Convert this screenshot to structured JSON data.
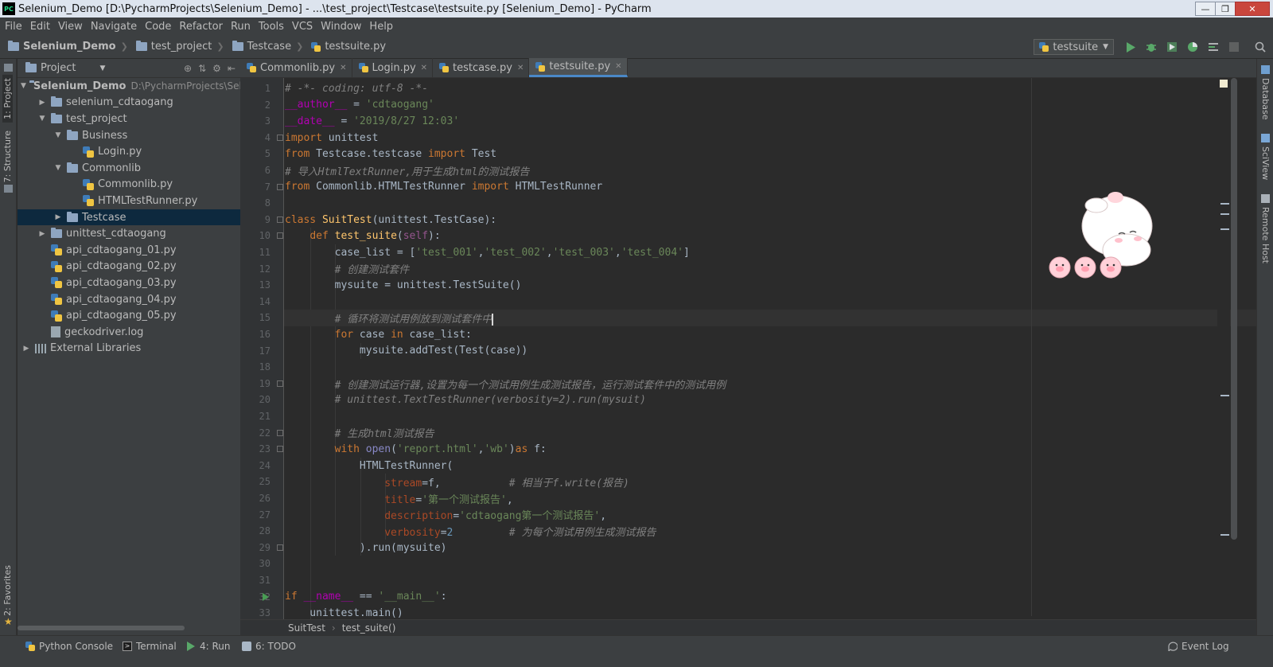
{
  "window": {
    "title": "Selenium_Demo [D:\\PycharmProjects\\Selenium_Demo] - ...\\test_project\\Testcase\\testsuite.py [Selenium_Demo] - PyCharm",
    "logo": "PC",
    "controls": [
      "minimize-icon",
      "restore-icon",
      "close-icon"
    ]
  },
  "menu": [
    "File",
    "Edit",
    "View",
    "Navigate",
    "Code",
    "Refactor",
    "Run",
    "Tools",
    "VCS",
    "Window",
    "Help"
  ],
  "nav": {
    "crumbs": [
      "Selenium_Demo",
      "test_project",
      "Testcase",
      "testsuite.py"
    ],
    "run_config": "testsuite",
    "tool_icons": [
      "run-icon",
      "debug-icon",
      "run-with-coverage-icon",
      "profile-icon",
      "concurrency-diagram-icon",
      "stop-icon",
      "search-everywhere-icon"
    ]
  },
  "left_tabs": [
    "1: Project",
    "7: Structure",
    "2: Favorites"
  ],
  "right_tabs": [
    "Database",
    "SciView",
    "Remote Host"
  ],
  "project": {
    "header": "Project",
    "header_tools": [
      "target-icon",
      "collapse-icon",
      "gear-icon",
      "hide-icon"
    ],
    "tree": [
      {
        "label": "Selenium_Demo",
        "path": "D:\\PycharmProjects\\Sel",
        "level": 0,
        "arrow": "down",
        "icon": "folder",
        "bold": true
      },
      {
        "label": "selenium_cdtaogang",
        "level": 1,
        "arrow": "right",
        "icon": "folder"
      },
      {
        "label": "test_project",
        "level": 1,
        "arrow": "down",
        "icon": "folder"
      },
      {
        "label": "Business",
        "level": 2,
        "arrow": "down",
        "icon": "folder"
      },
      {
        "label": "Login.py",
        "level": 3,
        "arrow": "none",
        "icon": "python"
      },
      {
        "label": "Commonlib",
        "level": 2,
        "arrow": "down",
        "icon": "folder"
      },
      {
        "label": "Commonlib.py",
        "level": 3,
        "arrow": "none",
        "icon": "python"
      },
      {
        "label": "HTMLTestRunner.py",
        "level": 3,
        "arrow": "none",
        "icon": "python"
      },
      {
        "label": "Testcase",
        "level": 2,
        "arrow": "right",
        "icon": "folder",
        "selected": true
      },
      {
        "label": "unittest_cdtaogang",
        "level": 1,
        "arrow": "right",
        "icon": "folder"
      },
      {
        "label": "api_cdtaogang_01.py",
        "level": 1,
        "arrow": "none",
        "icon": "python"
      },
      {
        "label": "api_cdtaogang_02.py",
        "level": 1,
        "arrow": "none",
        "icon": "python"
      },
      {
        "label": "api_cdtaogang_03.py",
        "level": 1,
        "arrow": "none",
        "icon": "python"
      },
      {
        "label": "api_cdtaogang_04.py",
        "level": 1,
        "arrow": "none",
        "icon": "python"
      },
      {
        "label": "api_cdtaogang_05.py",
        "level": 1,
        "arrow": "none",
        "icon": "python"
      },
      {
        "label": "geckodriver.log",
        "level": 1,
        "arrow": "none",
        "icon": "file"
      },
      {
        "label": "External Libraries",
        "level": 0,
        "arrow": "right",
        "icon": "library"
      }
    ]
  },
  "editor": {
    "tabs": [
      {
        "label": "Commonlib.py",
        "active": false
      },
      {
        "label": "Login.py",
        "active": false
      },
      {
        "label": "testcase.py",
        "active": false
      },
      {
        "label": "testsuite.py",
        "active": true
      }
    ],
    "current_line": 15,
    "lines": [
      [
        [
          "cmt",
          "# -*- coding: utf-8 -*-"
        ]
      ],
      [
        [
          "dunder",
          "__author__"
        ],
        [
          "plain",
          " = "
        ],
        [
          "str",
          "'cdtaogang'"
        ]
      ],
      [
        [
          "dunder",
          "__date__"
        ],
        [
          "plain",
          " = "
        ],
        [
          "str",
          "'2019/8/27 12:03'"
        ]
      ],
      [
        [
          "kw",
          "import"
        ],
        [
          "plain",
          " unittest"
        ]
      ],
      [
        [
          "kw",
          "from"
        ],
        [
          "plain",
          " Testcase.testcase "
        ],
        [
          "kw",
          "import"
        ],
        [
          "plain",
          " Test"
        ]
      ],
      [
        [
          "cmt",
          "# 导入HtmlTextRunner,用于生成html的测试报告"
        ]
      ],
      [
        [
          "kw",
          "from"
        ],
        [
          "plain",
          " Commonlib.HTMLTestRunner "
        ],
        [
          "kw",
          "import"
        ],
        [
          "plain",
          " HTMLTestRunner"
        ]
      ],
      [],
      [
        [
          "kw",
          "class"
        ],
        [
          "plain",
          " "
        ],
        [
          "def",
          "SuitTest"
        ],
        [
          "plain",
          "(unittest.TestCase):"
        ]
      ],
      [
        [
          "plain",
          "    "
        ],
        [
          "kw",
          "def"
        ],
        [
          "plain",
          " "
        ],
        [
          "def",
          "test_suite"
        ],
        [
          "plain",
          "("
        ],
        [
          "self",
          "self"
        ],
        [
          "plain",
          "):"
        ]
      ],
      [
        [
          "plain",
          "        case_list = ["
        ],
        [
          "str",
          "'test_001'"
        ],
        [
          "plain",
          ","
        ],
        [
          "str",
          "'test_002'"
        ],
        [
          "plain",
          ","
        ],
        [
          "str",
          "'test_003'"
        ],
        [
          "plain",
          ","
        ],
        [
          "str",
          "'test_004'"
        ],
        [
          "plain",
          "]"
        ]
      ],
      [
        [
          "plain",
          "        "
        ],
        [
          "cmt",
          "# 创建测试套件"
        ]
      ],
      [
        [
          "plain",
          "        mysuite = unittest.TestSuite()"
        ]
      ],
      [],
      [
        [
          "plain",
          "        "
        ],
        [
          "cmt",
          "# 循环将测试用例放到测试套件中"
        ],
        [
          "cursor",
          ""
        ]
      ],
      [
        [
          "plain",
          "        "
        ],
        [
          "kw",
          "for"
        ],
        [
          "plain",
          " case "
        ],
        [
          "kw",
          "in"
        ],
        [
          "plain",
          " case_list:"
        ]
      ],
      [
        [
          "plain",
          "            mysuite.addTest(Test(case))"
        ]
      ],
      [],
      [
        [
          "plain",
          "        "
        ],
        [
          "cmt",
          "# 创建测试运行器,设置为每一个测试用例生成测试报告，运行测试套件中的测试用例"
        ]
      ],
      [
        [
          "plain",
          "        "
        ],
        [
          "cmt",
          "# unittest.TextTestRunner(verbosity=2).run(mysuit)"
        ]
      ],
      [],
      [
        [
          "plain",
          "        "
        ],
        [
          "cmt",
          "# 生成html测试报告"
        ]
      ],
      [
        [
          "plain",
          "        "
        ],
        [
          "kw",
          "with"
        ],
        [
          "plain",
          " "
        ],
        [
          "builtin",
          "open"
        ],
        [
          "plain",
          "("
        ],
        [
          "str",
          "'report.html'"
        ],
        [
          "plain",
          ","
        ],
        [
          "str",
          "'wb'"
        ],
        [
          "plain",
          ")"
        ],
        [
          "kw",
          "as"
        ],
        [
          "plain",
          " f:"
        ]
      ],
      [
        [
          "plain",
          "            HTMLTestRunner("
        ]
      ],
      [
        [
          "plain",
          "                "
        ],
        [
          "param",
          "stream"
        ],
        [
          "plain",
          "=f,           "
        ],
        [
          "cmt",
          "# 相当于f.write(报告)"
        ]
      ],
      [
        [
          "plain",
          "                "
        ],
        [
          "param",
          "title"
        ],
        [
          "plain",
          "="
        ],
        [
          "str",
          "'第一个测试报告'"
        ],
        [
          "plain",
          ","
        ]
      ],
      [
        [
          "plain",
          "                "
        ],
        [
          "param",
          "description"
        ],
        [
          "plain",
          "="
        ],
        [
          "str",
          "'cdtaogang第一个测试报告'"
        ],
        [
          "plain",
          ","
        ]
      ],
      [
        [
          "plain",
          "                "
        ],
        [
          "param",
          "verbosity"
        ],
        [
          "plain",
          "="
        ],
        [
          "num",
          "2"
        ],
        [
          "plain",
          "         "
        ],
        [
          "cmt",
          "# 为每个测试用例生成测试报告"
        ]
      ],
      [
        [
          "plain",
          "            ).run(mysuite)"
        ]
      ],
      [],
      [],
      [
        [
          "kw",
          "if"
        ],
        [
          "plain",
          " "
        ],
        [
          "dunder",
          "__name__"
        ],
        [
          "plain",
          " == "
        ],
        [
          "str",
          "'__main__'"
        ],
        [
          "plain",
          ":"
        ]
      ],
      [
        [
          "plain",
          "    unittest.main()"
        ]
      ]
    ],
    "breadcrumbs": [
      "SuitTest",
      "test_suite()"
    ]
  },
  "bottom_tools": [
    {
      "label": "Python Console",
      "icon": "python-console-icon"
    },
    {
      "label": "Terminal",
      "icon": "terminal-icon"
    },
    {
      "label": "4: Run",
      "icon": "run-icon"
    },
    {
      "label": "6: TODO",
      "icon": "todo-icon"
    }
  ],
  "event_log": "Event Log",
  "colors": {
    "editor_bg": "#2b2b2b",
    "panel_bg": "#3c3f41",
    "keyword": "#cc7832",
    "string": "#6a8759",
    "comment": "#808080",
    "function": "#ffc66d",
    "selected_row": "#0d293e",
    "active_tab_underline": "#4a88c7"
  }
}
